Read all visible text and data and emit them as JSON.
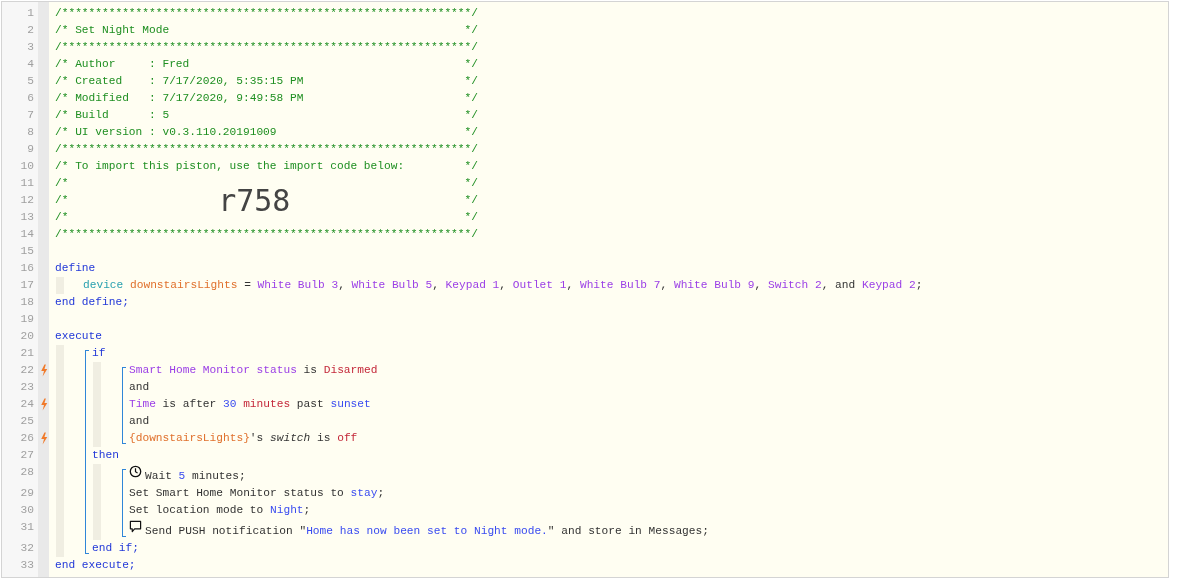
{
  "editor": {
    "lines": [
      {
        "kind": "line",
        "number": "1",
        "trigger": false,
        "segments": [
          {
            "kind": "comment",
            "text": "/*************************************************************/"
          }
        ]
      },
      {
        "kind": "line",
        "number": "2",
        "trigger": false,
        "segments": [
          {
            "kind": "comment",
            "text": "/* Set Night Mode "
          },
          {
            "kind": "comment-end",
            "text": "*/"
          }
        ]
      },
      {
        "kind": "line",
        "number": "3",
        "trigger": false,
        "segments": [
          {
            "kind": "comment",
            "text": "/*************************************************************/"
          }
        ]
      },
      {
        "kind": "line",
        "number": "4",
        "trigger": false,
        "segments": [
          {
            "kind": "comment",
            "text": "/* Author     : Fred "
          },
          {
            "kind": "comment-end",
            "text": "*/"
          }
        ]
      },
      {
        "kind": "line",
        "number": "5",
        "trigger": false,
        "segments": [
          {
            "kind": "comment",
            "text": "/* Created    : 7/17/2020, 5:35:15 PM "
          },
          {
            "kind": "comment-end",
            "text": "*/"
          }
        ]
      },
      {
        "kind": "line",
        "number": "6",
        "trigger": false,
        "segments": [
          {
            "kind": "comment",
            "text": "/* Modified   : 7/17/2020, 9:49:58 PM "
          },
          {
            "kind": "comment-end",
            "text": "*/"
          }
        ]
      },
      {
        "kind": "line",
        "number": "7",
        "trigger": false,
        "segments": [
          {
            "kind": "comment",
            "text": "/* Build      : 5 "
          },
          {
            "kind": "comment-end",
            "text": "*/"
          }
        ]
      },
      {
        "kind": "line",
        "number": "8",
        "trigger": false,
        "segments": [
          {
            "kind": "comment",
            "text": "/* UI version : v0.3.110.20191009 "
          },
          {
            "kind": "comment-end",
            "text": "*/"
          }
        ]
      },
      {
        "kind": "line",
        "number": "9",
        "trigger": false,
        "segments": [
          {
            "kind": "comment",
            "text": "/*************************************************************/"
          }
        ]
      },
      {
        "kind": "line",
        "number": "10",
        "trigger": false,
        "segments": [
          {
            "kind": "comment",
            "text": "/* To import this piston, use the import code below: "
          },
          {
            "kind": "comment-end",
            "text": "*/"
          }
        ]
      },
      {
        "kind": "line",
        "number": "11",
        "trigger": false,
        "segments": [
          {
            "kind": "comment",
            "text": "/* "
          },
          {
            "kind": "comment-end",
            "text": "*/"
          }
        ]
      },
      {
        "kind": "line",
        "number": "12",
        "trigger": false,
        "segments": [
          {
            "kind": "comment",
            "text": "/* "
          },
          {
            "kind": "import-code",
            "text": "r758"
          },
          {
            "kind": "comment-end",
            "text": " */"
          }
        ]
      },
      {
        "kind": "line",
        "number": "13",
        "trigger": false,
        "segments": [
          {
            "kind": "comment",
            "text": "/* "
          },
          {
            "kind": "comment-end",
            "text": "*/"
          }
        ]
      },
      {
        "kind": "line",
        "number": "14",
        "trigger": false,
        "segments": [
          {
            "kind": "comment",
            "text": "/*************************************************************/"
          }
        ]
      },
      {
        "kind": "line",
        "number": "15",
        "trigger": false
      },
      {
        "kind": "line",
        "number": "16",
        "trigger": false,
        "segments": [
          {
            "kind": "keyword",
            "text": "define"
          }
        ],
        "children": [
          {
            "kind": "line",
            "number": "17",
            "trigger": false,
            "segments": [
              {
                "kind": "type",
                "text": "device "
              },
              {
                "kind": "variable",
                "text": "downstairsLights"
              },
              {
                "kind": "plain",
                "text": " = "
              },
              {
                "kind": "device",
                "text": "White Bulb 3"
              },
              {
                "kind": "plain",
                "text": ", "
              },
              {
                "kind": "device",
                "text": "White Bulb 5"
              },
              {
                "kind": "plain",
                "text": ", "
              },
              {
                "kind": "device",
                "text": "Keypad 1"
              },
              {
                "kind": "plain",
                "text": ", "
              },
              {
                "kind": "device",
                "text": "Outlet 1"
              },
              {
                "kind": "plain",
                "text": ", "
              },
              {
                "kind": "device",
                "text": "White Bulb 7"
              },
              {
                "kind": "plain",
                "text": ", "
              },
              {
                "kind": "device",
                "text": "White Bulb 9"
              },
              {
                "kind": "plain",
                "text": ", "
              },
              {
                "kind": "device",
                "text": "Switch 2"
              },
              {
                "kind": "plain",
                "text": ", and "
              },
              {
                "kind": "device",
                "text": "Keypad 2"
              },
              {
                "kind": "plain",
                "text": ";"
              }
            ]
          }
        ]
      },
      {
        "kind": "line",
        "number": "18",
        "trigger": false,
        "segments": [
          {
            "kind": "keyword",
            "text": "end define;"
          }
        ]
      },
      {
        "kind": "line",
        "number": "19",
        "trigger": false
      },
      {
        "kind": "line",
        "number": "20",
        "trigger": false,
        "segments": [
          {
            "kind": "keyword",
            "text": "execute"
          }
        ],
        "children": [
          {
            "kind": "group",
            "children": [
              {
                "kind": "line",
                "number": "21",
                "trigger": false,
                "segments": [
                  {
                    "kind": "keyword",
                    "text": "if"
                  }
                ],
                "children": [
                  {
                    "kind": "group",
                    "children": [
                      {
                        "kind": "line",
                        "number": "22",
                        "trigger": true,
                        "segments": [
                          {
                            "kind": "device",
                            "text": "Smart Home Monitor status"
                          },
                          {
                            "kind": "plain",
                            "text": " is "
                          },
                          {
                            "kind": "value",
                            "text": "Disarmed"
                          }
                        ]
                      },
                      {
                        "kind": "line",
                        "number": "23",
                        "trigger": false,
                        "segments": [
                          {
                            "kind": "plain",
                            "text": "and"
                          }
                        ]
                      },
                      {
                        "kind": "line",
                        "number": "24",
                        "trigger": true,
                        "segments": [
                          {
                            "kind": "device",
                            "text": "Time"
                          },
                          {
                            "kind": "plain",
                            "text": " is after "
                          },
                          {
                            "kind": "literal",
                            "text": "30"
                          },
                          {
                            "kind": "value",
                            "text": " minutes"
                          },
                          {
                            "kind": "plain",
                            "text": " past "
                          },
                          {
                            "kind": "literal",
                            "text": "sunset"
                          }
                        ]
                      },
                      {
                        "kind": "line",
                        "number": "25",
                        "trigger": false,
                        "segments": [
                          {
                            "kind": "plain",
                            "text": "and"
                          }
                        ]
                      },
                      {
                        "kind": "line",
                        "number": "26",
                        "trigger": true,
                        "segments": [
                          {
                            "kind": "variable",
                            "text": "{downstairsLights}"
                          },
                          {
                            "kind": "plain",
                            "text": "'s "
                          },
                          {
                            "kind": "italic",
                            "text": "switch"
                          },
                          {
                            "kind": "plain",
                            "text": " is "
                          },
                          {
                            "kind": "value",
                            "text": "off"
                          }
                        ]
                      }
                    ]
                  }
                ]
              },
              {
                "kind": "line",
                "number": "27",
                "trigger": false,
                "segments": [
                  {
                    "kind": "keyword",
                    "text": "then"
                  }
                ],
                "children": [
                  {
                    "kind": "group",
                    "children": [
                      {
                        "kind": "wait",
                        "number": "28",
                        "trigger": false,
                        "segments": [
                          {
                            "kind": "plain",
                            "text": "Wait "
                          },
                          {
                            "kind": "literal",
                            "text": "5"
                          },
                          {
                            "kind": "plain",
                            "text": " minutes;"
                          }
                        ]
                      },
                      {
                        "kind": "line",
                        "number": "29",
                        "trigger": false,
                        "segments": [
                          {
                            "kind": "plain",
                            "text": "Set Smart Home Monitor status to "
                          },
                          {
                            "kind": "literal",
                            "text": "stay"
                          },
                          {
                            "kind": "plain",
                            "text": ";"
                          }
                        ]
                      },
                      {
                        "kind": "line",
                        "number": "30",
                        "trigger": false,
                        "segments": [
                          {
                            "kind": "plain",
                            "text": "Set location mode to "
                          },
                          {
                            "kind": "literal",
                            "text": "Night"
                          },
                          {
                            "kind": "plain",
                            "text": ";"
                          }
                        ]
                      },
                      {
                        "kind": "notification",
                        "number": "31",
                        "trigger": false,
                        "segments": [
                          {
                            "kind": "plain",
                            "text": "Send PUSH notification \""
                          },
                          {
                            "kind": "literal",
                            "text": "Home has now been set to Night mode."
                          },
                          {
                            "kind": "plain",
                            "text": "\" and store in Messages;"
                          }
                        ]
                      }
                    ]
                  }
                ]
              },
              {
                "kind": "line",
                "number": "32",
                "trigger": false,
                "segments": [
                  {
                    "kind": "keyword",
                    "text": "end if;"
                  }
                ]
              }
            ]
          }
        ]
      },
      {
        "kind": "line",
        "number": "33",
        "trigger": false,
        "segments": [
          {
            "kind": "keyword",
            "text": "end execute;"
          }
        ]
      }
    ]
  }
}
